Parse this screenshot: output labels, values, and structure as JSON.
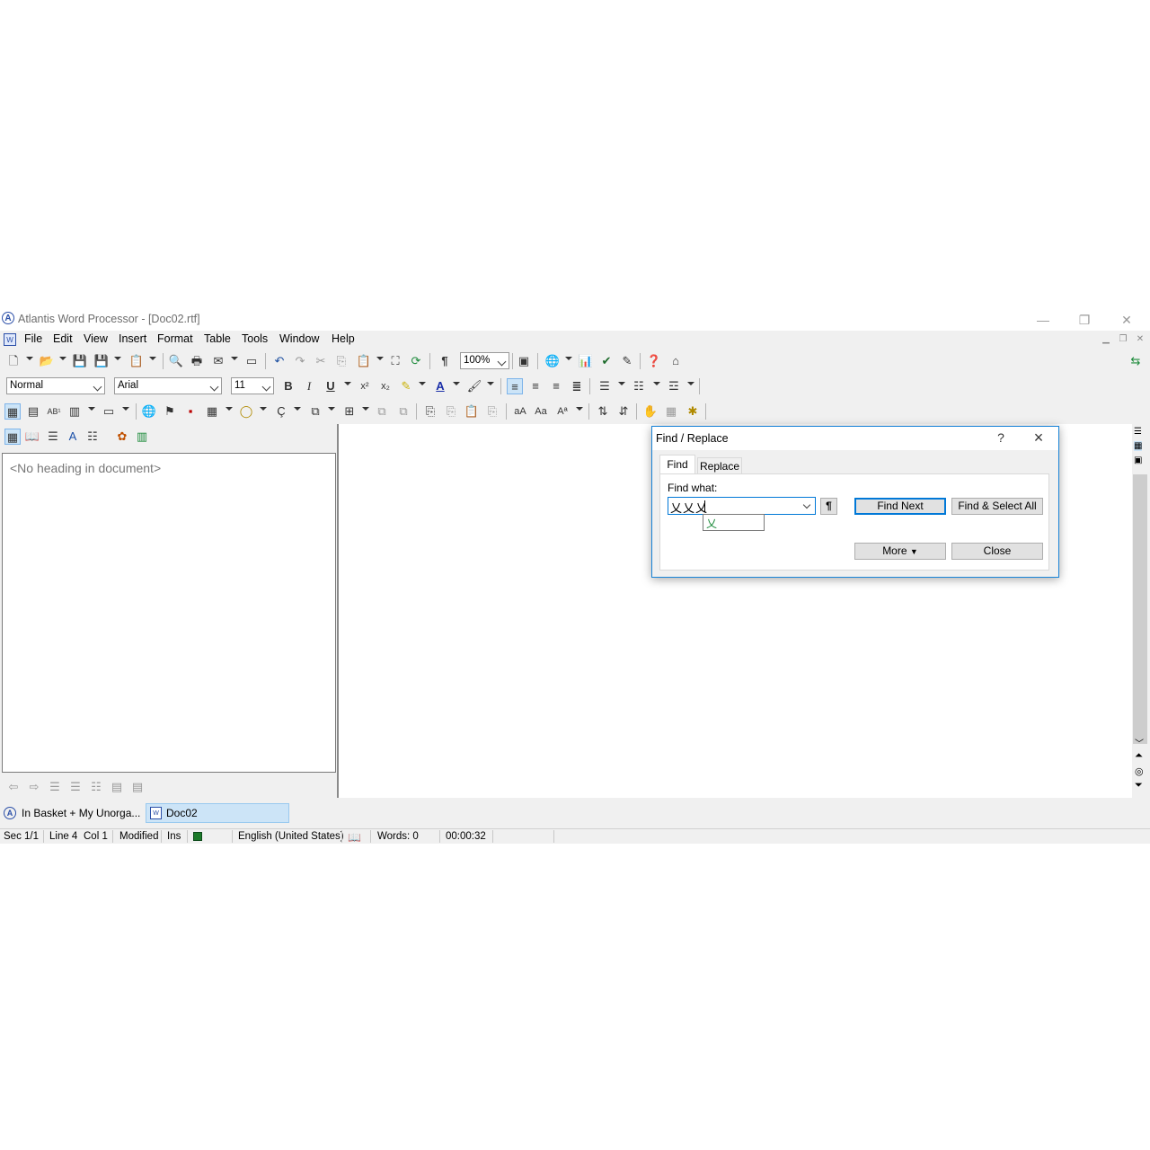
{
  "app": {
    "title": "Atlantis Word Processor - [Doc02.rtf]",
    "logo_icon": "atlantis-logo-icon"
  },
  "menu": [
    "File",
    "Edit",
    "View",
    "Insert",
    "Format",
    "Table",
    "Tools",
    "Window",
    "Help"
  ],
  "toolbar": {
    "zoom": "100%"
  },
  "format_bar": {
    "style": "Normal",
    "font": "Arial",
    "size": "11"
  },
  "nav_pane": {
    "placeholder": "<No heading in document>"
  },
  "doc_tabs": [
    {
      "label": "In Basket + My Unorga..."
    },
    {
      "label": "Doc02"
    }
  ],
  "status": {
    "section": "Sec 1/1",
    "line": "Line 4",
    "col": "Col 1",
    "modified": "Modified",
    "mode": "Ins",
    "language": "English (United States)",
    "words": "Words: 0",
    "timer": "00:00:32"
  },
  "dialog": {
    "title": "Find / Replace",
    "help": "?",
    "tabs": [
      "Find",
      "Replace"
    ],
    "find_label": "Find what:",
    "find_value": "乂乂乂",
    "autocomplete": "乂",
    "pilcrow": "¶",
    "buttons": {
      "find_next": "Find Next",
      "find_select_all": "Find & Select All",
      "more": "More",
      "close": "Close"
    }
  }
}
